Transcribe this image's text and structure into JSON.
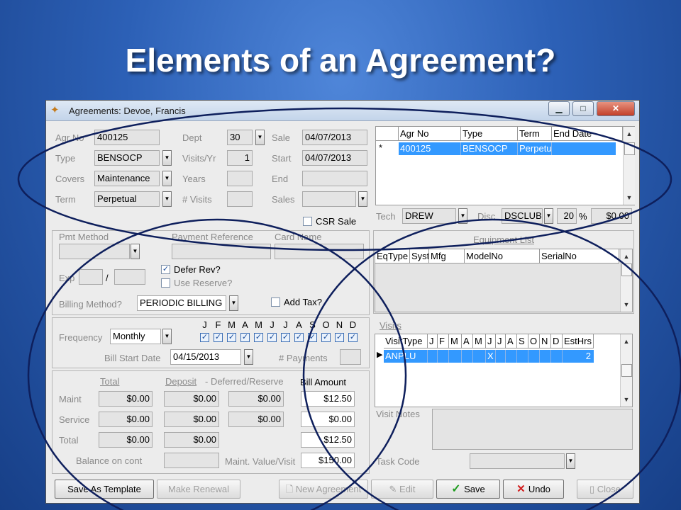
{
  "slide": {
    "title": "Elements of an Agreement?"
  },
  "window": {
    "title": "Agreements: Devoe, Francis",
    "min": "▁",
    "max": "□",
    "close": "✕"
  },
  "top_left": {
    "agr_no_label": "Agr No",
    "agr_no": "400125",
    "type_label": "Type",
    "type": "BENSOCP",
    "covers_label": "Covers",
    "covers": "Maintenance",
    "term_label": "Term",
    "term": "Perpetual",
    "dept_label": "Dept",
    "dept": "30",
    "visits_yr_label": "Visits/Yr",
    "visits_yr": "1",
    "years_label": "Years",
    "years": "",
    "num_visits_label": "# Visits",
    "num_visits": "",
    "sale_label": "Sale",
    "sale": "04/07/2013",
    "start_label": "Start",
    "start": "04/07/2013",
    "end_label": "End",
    "end": "",
    "sales_label": "Sales",
    "sales": "",
    "csr_sale_label": "CSR Sale"
  },
  "agreements_grid": {
    "columns": [
      "Agr No",
      "Type",
      "Term",
      "End Date"
    ],
    "marker": "*",
    "row": [
      "400125",
      "BENSOCP",
      "Perpetu",
      ""
    ]
  },
  "tech_row": {
    "tech_label": "Tech",
    "tech": "DREW",
    "disc_label": "Disc",
    "disc": "DSCLUB",
    "disc_pct": "20",
    "pct": "%",
    "amount": "$0.00"
  },
  "payment": {
    "pmt_method_label": "Pmt Method",
    "payment_ref_label": "Payment Reference",
    "card_name_label": "Card Name",
    "exp_label": "Exp",
    "slash": "/",
    "defer_rev_label": "Defer Rev?",
    "use_reserve_label": "Use Reserve?",
    "billing_method_label": "Billing Method?",
    "billing_method": "PERIODIC BILLING",
    "add_tax_label": "Add Tax?"
  },
  "frequency": {
    "frequency_label": "Frequency",
    "frequency": "Monthly",
    "months": [
      "J",
      "F",
      "M",
      "A",
      "M",
      "J",
      "J",
      "A",
      "S",
      "O",
      "N",
      "D"
    ],
    "bill_start_label": "Bill Start Date",
    "bill_start": "04/15/2013",
    "payments_label": "# Payments",
    "payments": ""
  },
  "amounts": {
    "total_col": "Total",
    "deposit_col": "Deposit",
    "deferred_col": "- Deferred/Reserve",
    "bill_col": "Bill Amount",
    "maint_label": "Maint",
    "service_label": "Service",
    "total_label": "Total",
    "maint_total": "$0.00",
    "maint_deposit": "$0.00",
    "maint_deferred": "$0.00",
    "maint_bill": "$12.50",
    "service_total": "$0.00",
    "service_deposit": "$0.00",
    "service_deferred": "$0.00",
    "service_bill": "$0.00",
    "total_total": "$0.00",
    "total_deposit": "$0.00",
    "total_bill": "$12.50",
    "balance_label": "Balance on cont",
    "maint_value_label": "Maint. Value/Visit",
    "maint_value": "$150.00"
  },
  "equipment": {
    "title": "Equipment List",
    "columns": [
      "EqType",
      "Syst",
      "Mfg",
      "ModelNo",
      "SerialNo"
    ]
  },
  "visits": {
    "title": "Visits",
    "columns": [
      "VisitType",
      "J",
      "F",
      "M",
      "A",
      "M",
      "J",
      "J",
      "A",
      "S",
      "O",
      "N",
      "D",
      "EstHrs"
    ],
    "row": [
      "ANPLU",
      "",
      "",
      "",
      "",
      "",
      "X",
      "",
      "",
      "",
      "",
      "",
      "",
      "2"
    ],
    "marker": "▶",
    "notes_label": "Visit Notes",
    "task_code_label": "Task Code"
  },
  "buttons": {
    "save_template": "Save As Template",
    "make_renewal": "Make Renewal",
    "new_agreement": "New Agreement",
    "edit": "Edit",
    "save": "Save",
    "undo": "Undo",
    "close": "Close"
  },
  "colors": {
    "selection": "#3399ff",
    "ellipse": "#0e1f5c"
  }
}
